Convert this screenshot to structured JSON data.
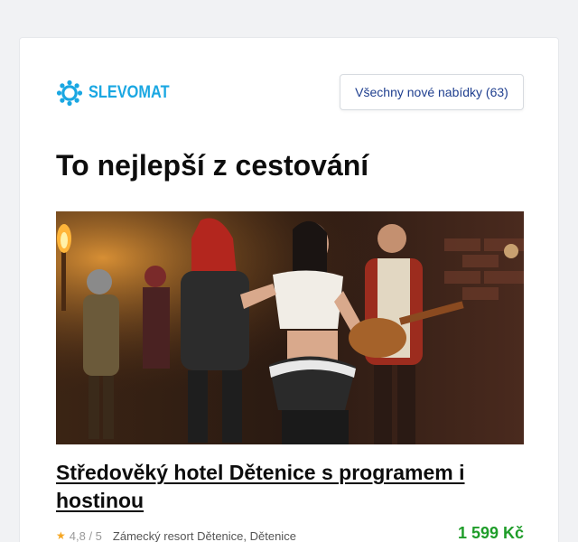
{
  "brand": {
    "name": "SLEVOMAT",
    "color": "#1aa7e2",
    "icon": "gear-logo-icon"
  },
  "header": {
    "all_offers_label": "Všechny nové nabídky (63)"
  },
  "section": {
    "title": "To nejlepší z cestování"
  },
  "offer": {
    "image_alt": "Středověký hotel Dětenice – tanečnice a hudebníci",
    "title": "Středověký hotel Dětenice s programem i hostinou",
    "rating": "4,8 / 5",
    "location": "Zámecký resort Dětenice, Dětenice",
    "price": "1 599 Kč",
    "price_color": "#1f9d2a",
    "star_icon": "star-icon"
  }
}
